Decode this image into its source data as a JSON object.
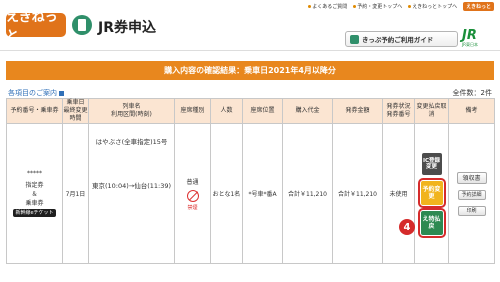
{
  "top_links": {
    "faq": "よくあるご質問",
    "reserve_top": "予約・変更トップへ",
    "ekinet_top": "えきねっとトップへ",
    "ekinet_badge": "えきねっと"
  },
  "header": {
    "logo": "えきねっと",
    "title": "JR券申込",
    "guide_button": "きっぷ予約ご利用ガイド",
    "jr_logo": "JR",
    "jr_logo_sub": "JR東日本"
  },
  "band_text": "購入内容の確認結果：乗車日2021年4月以降分",
  "sublink": "各項目のご案内",
  "count_text": "全件数：2件",
  "table": {
    "headers": {
      "reservation_no": "予約番号・乗車券",
      "ride_date": "乗車日",
      "last_change": "最終変更時間",
      "train_name": "列車名",
      "section_time": "利用区間(時刻)",
      "seat_type": "座席種別",
      "people": "人数",
      "seat_pos": "座席位置",
      "price": "購入代金",
      "issue_amount": "発券金額",
      "issue_status": "発券状況",
      "issue_no": "発券番号",
      "change_refund": "変更払戻取消",
      "note": "備考"
    },
    "row": {
      "reservation_no": "*****",
      "ticket_type_1": "指定券",
      "ticket_type_2": "乗車券",
      "shinkansen_badge": "新幹線eチケット",
      "ride_date": "7月1日",
      "train_name": "はやぶさ(全車指定)15号",
      "route": "東京(10:04)→仙台(11:39)",
      "seat_type": "普通",
      "no_smoking": "禁煙",
      "people": "おとな1名",
      "seat_pos": "*号車*番A",
      "price": "合計￥11,210",
      "issue_amount": "合計￥11,210",
      "issue_status": "未使用",
      "ic_button": "IC登録変更",
      "change_button": "予約変更",
      "refund_button": "え特払戻",
      "receipt_button": "領収書",
      "detail_button": "予約詳細",
      "print_button": "印刷"
    }
  },
  "step_marker": "4"
}
